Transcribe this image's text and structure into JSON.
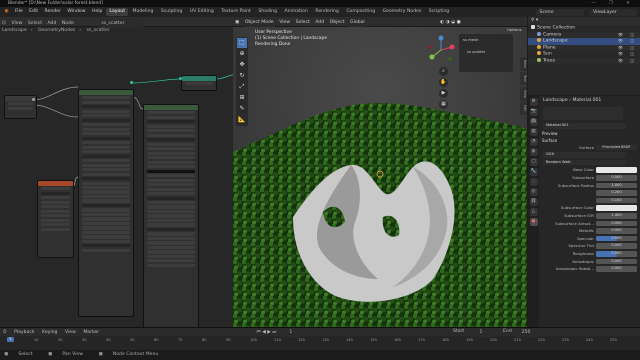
{
  "app": {
    "title": "Blender* [D:\\New Folder\\solar forest.blend]"
  },
  "menubar": {
    "menus": [
      "File",
      "Edit",
      "Render",
      "Window",
      "Help"
    ],
    "workspaces": [
      "Layout",
      "Modeling",
      "Sculpting",
      "UV Editing",
      "Texture Paint",
      "Shading",
      "Animation",
      "Rendering",
      "Compositing",
      "Geometry Nodes",
      "Scripting"
    ],
    "active_workspace": "Layout",
    "scene": "Scene",
    "view_layer": "ViewLayer"
  },
  "node_editor": {
    "header": [
      "Geometry Node Editor",
      "View",
      "Select",
      "Add",
      "Node"
    ],
    "tree_name": "ss_scatter",
    "breadcrumb": [
      "Landscape",
      "GeometryNodes",
      "ss_scatter"
    ]
  },
  "viewport": {
    "header": [
      "Object Mode",
      "View",
      "Select",
      "Add",
      "Object",
      "Global"
    ],
    "overlay_lines": [
      "User Perspective",
      "(1) Scene Collection | Landscape",
      "Rendering Done"
    ],
    "panel_items": [
      "ss mesh",
      "ss scatter"
    ],
    "options_label": "Options",
    "side_tabs": [
      "Item",
      "Tool",
      "View",
      "Edit"
    ]
  },
  "outliner": {
    "title": "Scene Collection",
    "items": [
      {
        "name": "Camera",
        "color": "#7c9bd0"
      },
      {
        "name": "Landscape",
        "color": "#e6a23c",
        "selected": true
      },
      {
        "name": "Plane",
        "color": "#e6a23c"
      },
      {
        "name": "Sun",
        "color": "#e6a23c"
      },
      {
        "name": "Trees",
        "color": "#a0c15c"
      }
    ]
  },
  "properties": {
    "object": "Landscape",
    "material": "Material.001",
    "slot_field": "Material.001",
    "sections": [
      "Preview",
      "Surface"
    ],
    "surface_shader": "Principled BSDF",
    "distribution": "GGX",
    "subsurface_method": "Random Walk",
    "rows": [
      {
        "label": "Base Color",
        "value": "",
        "style": "white"
      },
      {
        "label": "Subsurface",
        "value": "0.000",
        "style": ""
      },
      {
        "label": "Subsurface Radius",
        "value": "1.000",
        "style": ""
      },
      {
        "label": "",
        "value": "0.200",
        "style": ""
      },
      {
        "label": "",
        "value": "0.100",
        "style": ""
      },
      {
        "label": "Subsurface Color",
        "value": "",
        "style": "white"
      },
      {
        "label": "Subsurface IOR",
        "value": "1.400",
        "style": ""
      },
      {
        "label": "Subsurface Anisot...",
        "value": "0.000",
        "style": ""
      },
      {
        "label": "Metallic",
        "value": "0.000",
        "style": ""
      },
      {
        "label": "Specular",
        "value": "0.500",
        "style": "blue"
      },
      {
        "label": "Specular Tint",
        "value": "0.000",
        "style": ""
      },
      {
        "label": "Roughness",
        "value": "0.500",
        "style": "blue"
      },
      {
        "label": "Anisotropic",
        "value": "0.000",
        "style": ""
      },
      {
        "label": "Anisotropic Rotati...",
        "value": "0.000",
        "style": ""
      }
    ]
  },
  "timeline": {
    "menus": [
      "Playback",
      "Keying",
      "View",
      "Marker"
    ],
    "current_frame": "1",
    "start_label": "Start",
    "start": "1",
    "end_label": "End",
    "end": "250",
    "ticks": [
      "0",
      "10",
      "20",
      "30",
      "40",
      "50",
      "60",
      "70",
      "80",
      "90",
      "100",
      "110",
      "120",
      "130",
      "140",
      "150",
      "160",
      "170",
      "180",
      "190",
      "200",
      "210",
      "220",
      "230",
      "240",
      "250"
    ]
  },
  "statusbar": {
    "items": [
      "Select",
      "Pan View",
      "Node Context Menu"
    ]
  }
}
